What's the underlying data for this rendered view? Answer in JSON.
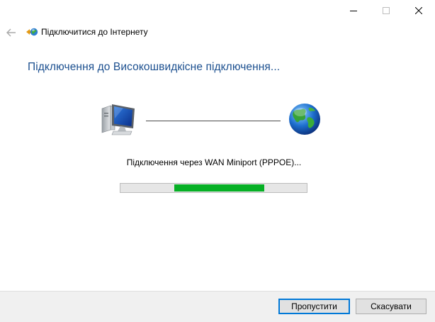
{
  "window": {
    "title": "Підключитися до Інтернету",
    "controls": {
      "minimize_icon": "minimize-icon",
      "maximize_icon": "maximize-icon",
      "close_icon": "close-icon"
    }
  },
  "main": {
    "heading": "Підключення до Високошвидкісне підключення...",
    "status": "Підключення через WAN Miniport (PPPOE)...",
    "progress": {
      "fill_start": 0.29,
      "fill_end": 0.77,
      "color": "#06b025"
    }
  },
  "footer": {
    "skip_label": "Пропустити",
    "cancel_label": "Скасувати"
  },
  "colors": {
    "heading": "#1b4f8f",
    "accent": "#0078d7"
  }
}
